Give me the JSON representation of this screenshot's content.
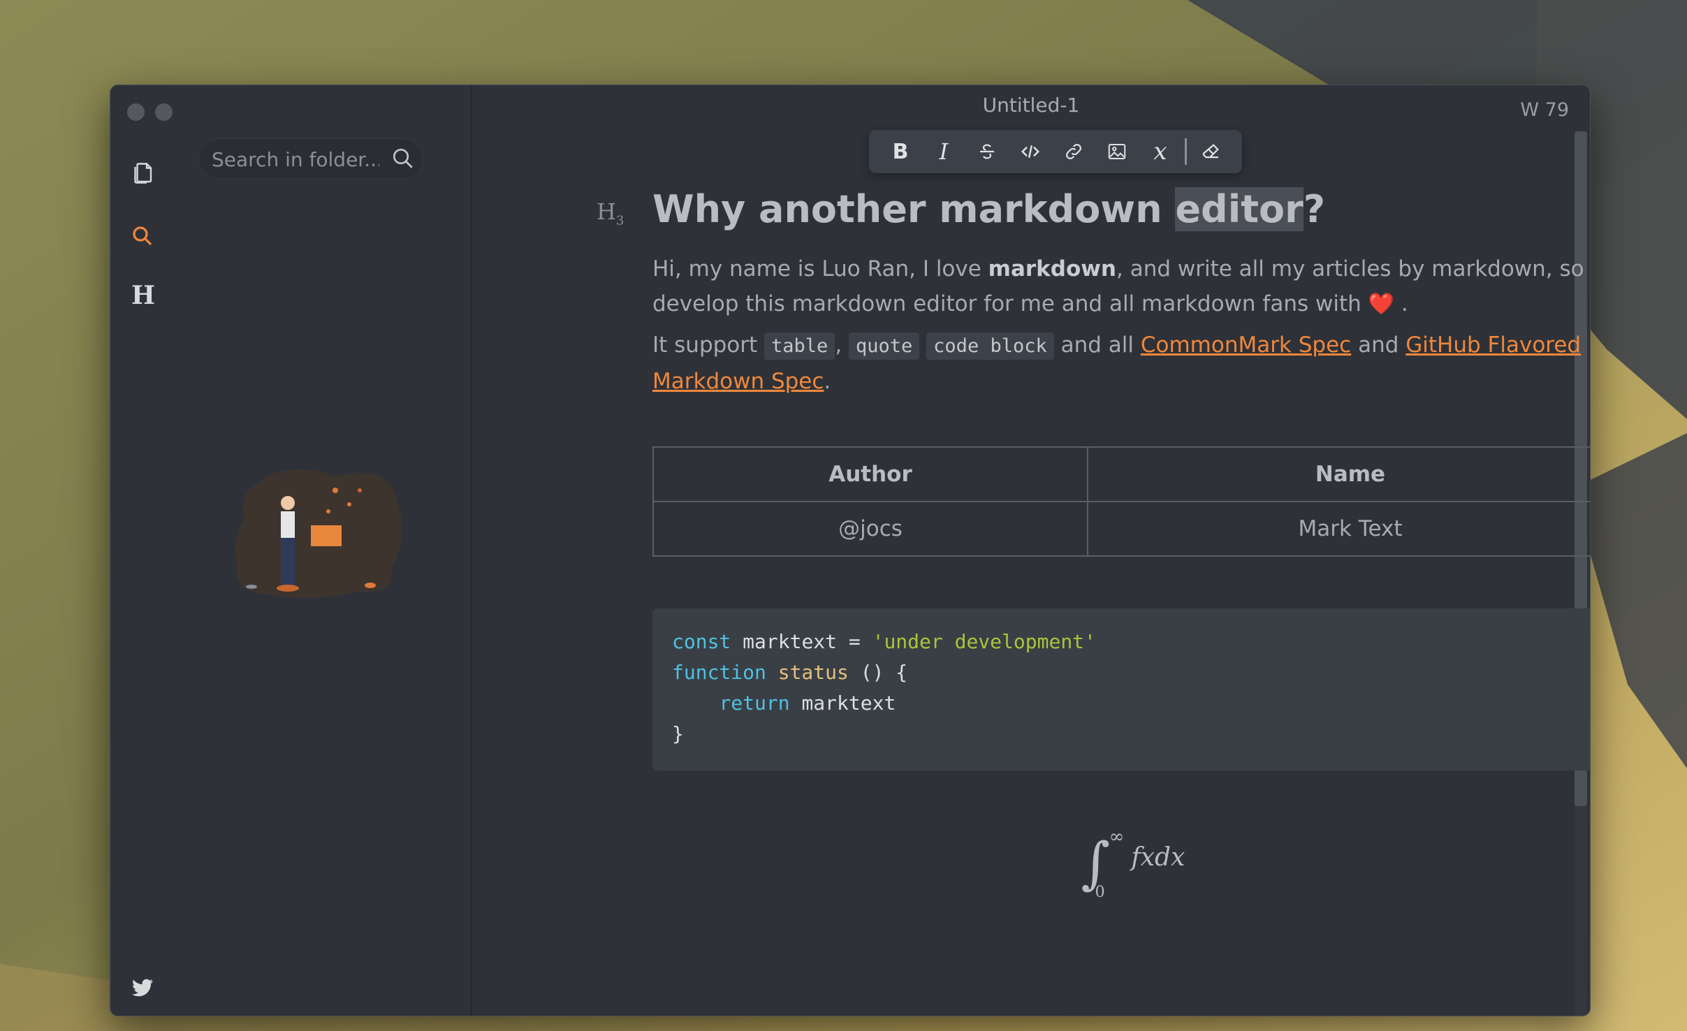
{
  "window": {
    "title": "Untitled-1",
    "word_count": "W 79"
  },
  "sidebar": {
    "search_placeholder": "Search in folder..."
  },
  "activity_icons": [
    "files-icon",
    "search-icon",
    "heading-icon",
    "twitter-icon"
  ],
  "activity_heading_glyph": "H",
  "toolbar": {
    "bold": "B",
    "italic": "I",
    "math": "x"
  },
  "doc": {
    "heading_marker": "H",
    "heading_marker_level": "3",
    "heading_pre": "Why another markdown ",
    "heading_highlight": "editor",
    "heading_post": "?",
    "para1_a": "Hi, my name is Luo Ran, I love ",
    "para1_bold": "markdown",
    "para1_b": ", and write all my articles by markdown, so I develop this markdown editor for me and all markdown fans with ",
    "para1_heart": "❤️",
    "para1_end": " .",
    "para2_a": "It support ",
    "code_table": "table",
    "comma": ",",
    "code_quote": "quote",
    "code_block": "code block",
    "para2_b": " and all ",
    "link1": "CommonMark Spec",
    "para2_c": " and ",
    "link2": "GitHub Flavored Markdown Spec",
    "para2_end": ".",
    "table": {
      "headers": [
        "Author",
        "Name"
      ],
      "rows": [
        [
          "@jocs",
          "Mark Text"
        ]
      ]
    },
    "code": {
      "l1_kw": "const",
      "l1_rest": " marktext = ",
      "l1_str": "'under development'",
      "l2_kw": "function",
      "l2_fn": "status",
      "l2_rest": " () {",
      "l3_indent": "    ",
      "l3_kw": "return",
      "l3_rest": " marktext",
      "l4": "}"
    },
    "math": {
      "integral": "∫",
      "upper": "∞",
      "lower": "0",
      "expr": "fxdx"
    }
  },
  "colors": {
    "accent": "#f0873c",
    "window_bg": "#2e3238",
    "keyword": "#4fc1e0",
    "string": "#a5c73a",
    "function": "#e5c07b"
  }
}
